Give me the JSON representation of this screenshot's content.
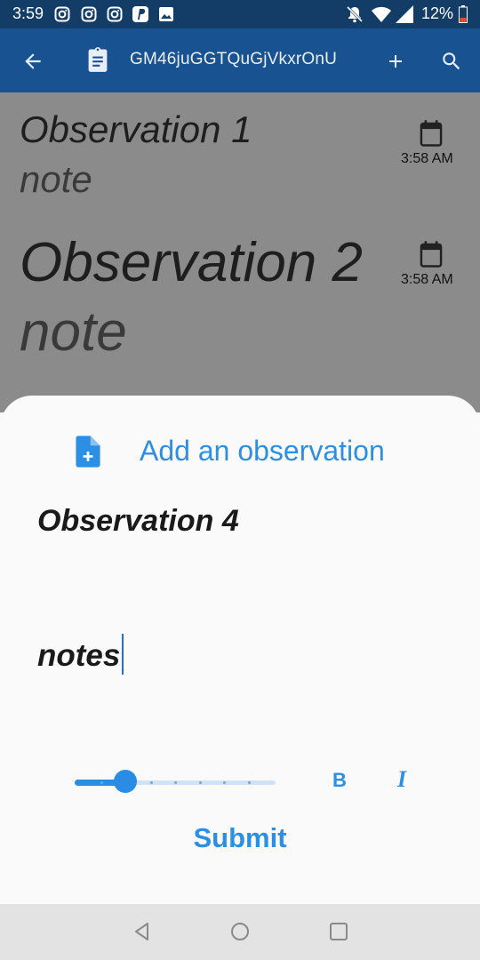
{
  "status_bar": {
    "time": "3:59",
    "battery": "12%",
    "left_icons": [
      "instagram-icon",
      "instagram-icon",
      "instagram-icon",
      "paypal-icon",
      "image-icon"
    ],
    "right_icons": [
      "notifications-off-icon",
      "wifi-icon",
      "signal-icon",
      "battery-icon"
    ]
  },
  "app_bar": {
    "title": "GM46juGGTQuGjVkxrOnU",
    "background": "#195290"
  },
  "list": {
    "items": [
      {
        "title": "Observation 1",
        "note": "note",
        "time": "3:58 AM"
      },
      {
        "title": "Observation 2",
        "note": "note",
        "time": "3:58 AM"
      }
    ]
  },
  "sheet": {
    "header": "Add an observation",
    "observation_value": "Observation 4",
    "notes_value": "notes",
    "slider_level": 0.25,
    "bold_label": "B",
    "italic_label": "I",
    "submit_label": "Submit",
    "accent": "#2d8fe4"
  }
}
